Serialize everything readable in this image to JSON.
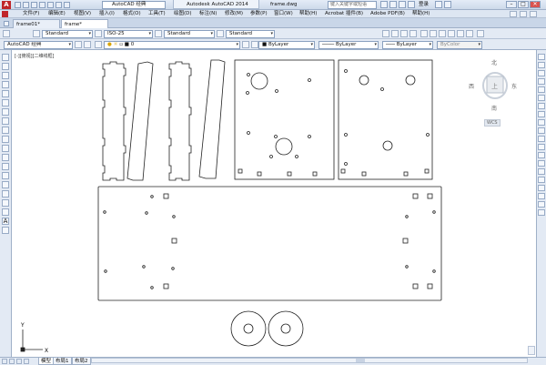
{
  "titlebar": {
    "app_title": "Autodesk AutoCAD 2014",
    "file_name": "frame.dwg",
    "workspace": "AutoCAD 经典",
    "help_search_placeholder": "键入关键字或短语",
    "login_label": "登录"
  },
  "menubar": {
    "items": [
      "文件(F)",
      "编辑(E)",
      "视图(V)",
      "插入(I)",
      "格式(O)",
      "工具(T)",
      "绘图(D)",
      "标注(N)",
      "修改(M)",
      "参数(P)",
      "窗口(W)",
      "帮助(H)",
      "Acrobat 插件(B)",
      "Adobe PDF(B)",
      "帮助(H)"
    ]
  },
  "file_tabs": [
    "frame01*",
    "frame*"
  ],
  "toolbar1": {
    "text_style": "Standard",
    "dim_style": "ISO-25",
    "table_style": "Standard",
    "multileader_style": "Standard"
  },
  "toolbar2": {
    "workspace": "AutoCAD 经典",
    "layer": "0",
    "color": "ByLayer",
    "linetype": "ByLayer",
    "lineweight": "ByLayer",
    "plot_style": "ByColor"
  },
  "canvas": {
    "view_label": "[-][俯视][二维线框]"
  },
  "viewcube": {
    "north": "北",
    "south": "南",
    "east": "东",
    "west": "西",
    "face": "上",
    "wcs": "WCS"
  },
  "ucs": {
    "x": "X",
    "y": "Y"
  },
  "layout_tabs": [
    "模型",
    "布局1",
    "布局2"
  ],
  "colors": {
    "accent": "#c0262a",
    "chrome": "#e3eaf4",
    "canvas": "#ffffff"
  }
}
